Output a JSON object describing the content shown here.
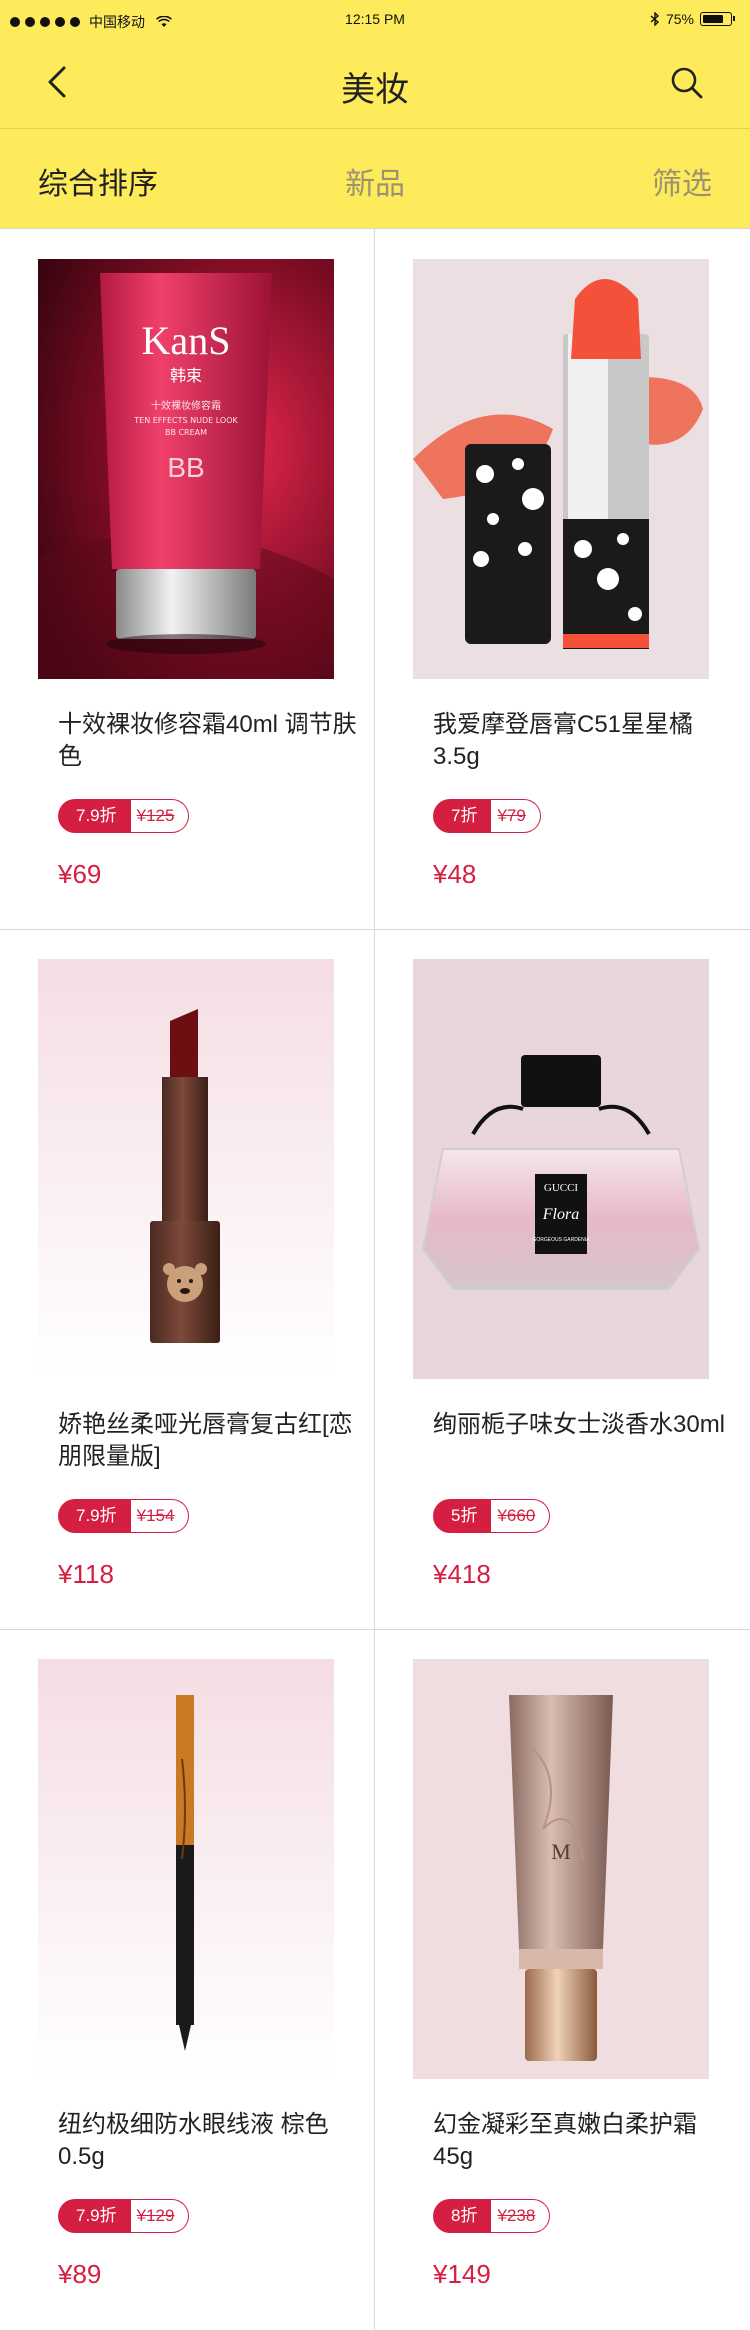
{
  "status_bar": {
    "carrier": "中国移动",
    "time": "12:15 PM",
    "battery": "75%",
    "battery_level": 0.75
  },
  "nav": {
    "title": "美妆",
    "back_icon": "chevron-left-icon",
    "search_icon": "search-icon"
  },
  "filters": {
    "sort": "综合排序",
    "new": "新品",
    "filter": "筛选"
  },
  "colors": {
    "header_bg": "#fdeb5b",
    "accent": "#d41f42"
  },
  "products": [
    {
      "title": "十效裸妆修容霜40ml 调节肤色",
      "discount": "7.9折",
      "original_price": "¥125",
      "price": "¥69"
    },
    {
      "title": "我爱摩登唇膏C51星星橘 3.5g",
      "discount": "7折",
      "original_price": "¥79",
      "price": "¥48"
    },
    {
      "title": "娇艳丝柔哑光唇膏复古红[恋朋限量版]",
      "discount": "7.9折",
      "original_price": "¥154",
      "price": "¥118"
    },
    {
      "title": "绚丽栀子味女士淡香水30ml",
      "discount": "5折",
      "original_price": "¥660",
      "price": "¥418"
    },
    {
      "title": "纽约极细防水眼线液 棕色0.5g",
      "discount": "7.9折",
      "original_price": "¥129",
      "price": "¥89"
    },
    {
      "title": "幻金凝彩至真嫩白柔护霜45g",
      "discount": "8折",
      "original_price": "¥238",
      "price": "¥149"
    }
  ],
  "product_image_text": {
    "bb_brand": "KanS",
    "bb_sub": "韩束",
    "bb_line1": "十效裸妆修容霜",
    "bb_line2": "TEN EFFECTS NUDE LOOK",
    "bb_line3": "BB CREAM",
    "bb_big": "BB",
    "perfume_brand": "GUCCI",
    "perfume_name": "Flora",
    "perfume_sub": "GORGEOUS GARDENIA",
    "cream_brand": "M"
  }
}
